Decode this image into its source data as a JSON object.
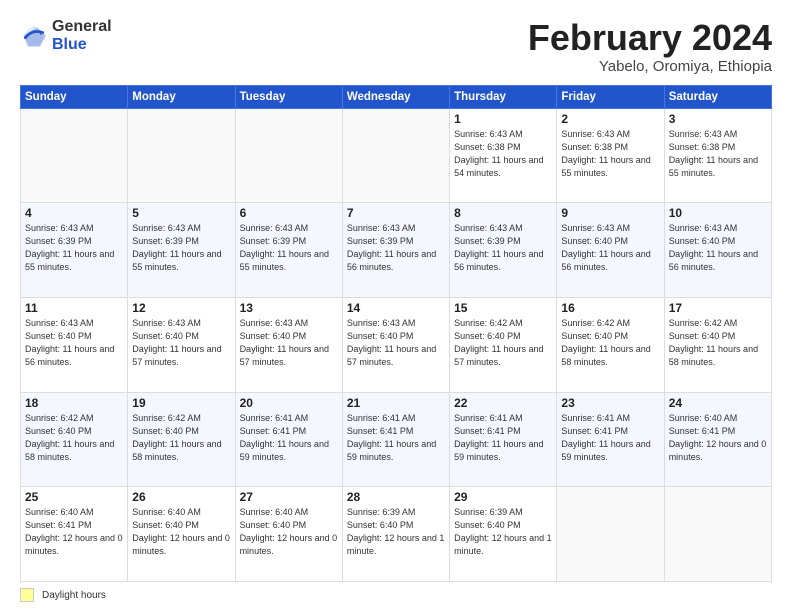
{
  "logo": {
    "general": "General",
    "blue": "Blue"
  },
  "header": {
    "month": "February 2024",
    "location": "Yabelo, Oromiya, Ethiopia"
  },
  "weekdays": [
    "Sunday",
    "Monday",
    "Tuesday",
    "Wednesday",
    "Thursday",
    "Friday",
    "Saturday"
  ],
  "footer": {
    "legend_label": "Daylight hours"
  },
  "weeks": [
    [
      {
        "day": "",
        "info": ""
      },
      {
        "day": "",
        "info": ""
      },
      {
        "day": "",
        "info": ""
      },
      {
        "day": "",
        "info": ""
      },
      {
        "day": "1",
        "info": "Sunrise: 6:43 AM\nSunset: 6:38 PM\nDaylight: 11 hours\nand 54 minutes."
      },
      {
        "day": "2",
        "info": "Sunrise: 6:43 AM\nSunset: 6:38 PM\nDaylight: 11 hours\nand 55 minutes."
      },
      {
        "day": "3",
        "info": "Sunrise: 6:43 AM\nSunset: 6:38 PM\nDaylight: 11 hours\nand 55 minutes."
      }
    ],
    [
      {
        "day": "4",
        "info": "Sunrise: 6:43 AM\nSunset: 6:39 PM\nDaylight: 11 hours\nand 55 minutes."
      },
      {
        "day": "5",
        "info": "Sunrise: 6:43 AM\nSunset: 6:39 PM\nDaylight: 11 hours\nand 55 minutes."
      },
      {
        "day": "6",
        "info": "Sunrise: 6:43 AM\nSunset: 6:39 PM\nDaylight: 11 hours\nand 55 minutes."
      },
      {
        "day": "7",
        "info": "Sunrise: 6:43 AM\nSunset: 6:39 PM\nDaylight: 11 hours\nand 56 minutes."
      },
      {
        "day": "8",
        "info": "Sunrise: 6:43 AM\nSunset: 6:39 PM\nDaylight: 11 hours\nand 56 minutes."
      },
      {
        "day": "9",
        "info": "Sunrise: 6:43 AM\nSunset: 6:40 PM\nDaylight: 11 hours\nand 56 minutes."
      },
      {
        "day": "10",
        "info": "Sunrise: 6:43 AM\nSunset: 6:40 PM\nDaylight: 11 hours\nand 56 minutes."
      }
    ],
    [
      {
        "day": "11",
        "info": "Sunrise: 6:43 AM\nSunset: 6:40 PM\nDaylight: 11 hours\nand 56 minutes."
      },
      {
        "day": "12",
        "info": "Sunrise: 6:43 AM\nSunset: 6:40 PM\nDaylight: 11 hours\nand 57 minutes."
      },
      {
        "day": "13",
        "info": "Sunrise: 6:43 AM\nSunset: 6:40 PM\nDaylight: 11 hours\nand 57 minutes."
      },
      {
        "day": "14",
        "info": "Sunrise: 6:43 AM\nSunset: 6:40 PM\nDaylight: 11 hours\nand 57 minutes."
      },
      {
        "day": "15",
        "info": "Sunrise: 6:42 AM\nSunset: 6:40 PM\nDaylight: 11 hours\nand 57 minutes."
      },
      {
        "day": "16",
        "info": "Sunrise: 6:42 AM\nSunset: 6:40 PM\nDaylight: 11 hours\nand 58 minutes."
      },
      {
        "day": "17",
        "info": "Sunrise: 6:42 AM\nSunset: 6:40 PM\nDaylight: 11 hours\nand 58 minutes."
      }
    ],
    [
      {
        "day": "18",
        "info": "Sunrise: 6:42 AM\nSunset: 6:40 PM\nDaylight: 11 hours\nand 58 minutes."
      },
      {
        "day": "19",
        "info": "Sunrise: 6:42 AM\nSunset: 6:40 PM\nDaylight: 11 hours\nand 58 minutes."
      },
      {
        "day": "20",
        "info": "Sunrise: 6:41 AM\nSunset: 6:41 PM\nDaylight: 11 hours\nand 59 minutes."
      },
      {
        "day": "21",
        "info": "Sunrise: 6:41 AM\nSunset: 6:41 PM\nDaylight: 11 hours\nand 59 minutes."
      },
      {
        "day": "22",
        "info": "Sunrise: 6:41 AM\nSunset: 6:41 PM\nDaylight: 11 hours\nand 59 minutes."
      },
      {
        "day": "23",
        "info": "Sunrise: 6:41 AM\nSunset: 6:41 PM\nDaylight: 11 hours\nand 59 minutes."
      },
      {
        "day": "24",
        "info": "Sunrise: 6:40 AM\nSunset: 6:41 PM\nDaylight: 12 hours\nand 0 minutes."
      }
    ],
    [
      {
        "day": "25",
        "info": "Sunrise: 6:40 AM\nSunset: 6:41 PM\nDaylight: 12 hours\nand 0 minutes."
      },
      {
        "day": "26",
        "info": "Sunrise: 6:40 AM\nSunset: 6:40 PM\nDaylight: 12 hours\nand 0 minutes."
      },
      {
        "day": "27",
        "info": "Sunrise: 6:40 AM\nSunset: 6:40 PM\nDaylight: 12 hours\nand 0 minutes."
      },
      {
        "day": "28",
        "info": "Sunrise: 6:39 AM\nSunset: 6:40 PM\nDaylight: 12 hours\nand 1 minute."
      },
      {
        "day": "29",
        "info": "Sunrise: 6:39 AM\nSunset: 6:40 PM\nDaylight: 12 hours\nand 1 minute."
      },
      {
        "day": "",
        "info": ""
      },
      {
        "day": "",
        "info": ""
      }
    ]
  ]
}
